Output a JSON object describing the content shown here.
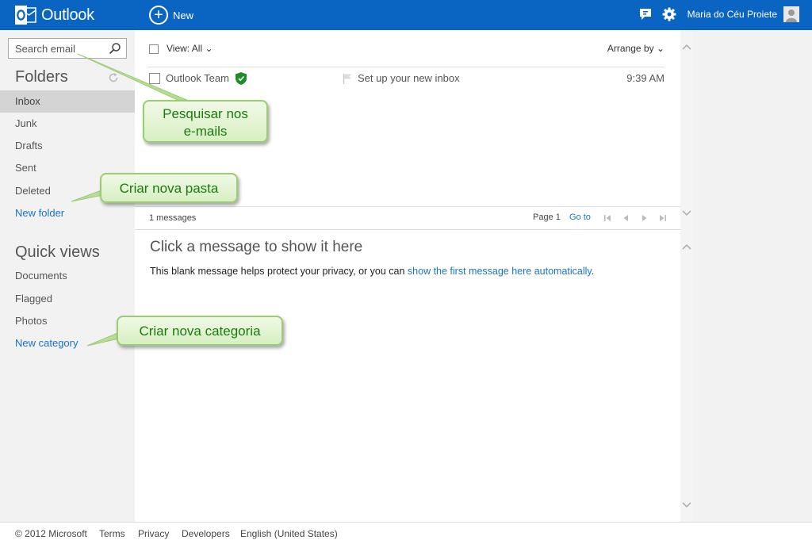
{
  "header": {
    "app_name": "Outlook",
    "new_label": "New",
    "user_name": "Maria do Céu Proiete",
    "brand_color": "#0a64c2"
  },
  "sidebar": {
    "search_placeholder": "Search email",
    "folders_title": "Folders",
    "folders": [
      {
        "label": "Inbox",
        "active": true
      },
      {
        "label": "Junk"
      },
      {
        "label": "Drafts"
      },
      {
        "label": "Sent"
      },
      {
        "label": "Deleted"
      }
    ],
    "new_folder": "New folder",
    "quick_views_title": "Quick views",
    "quick_views": [
      {
        "label": "Documents"
      },
      {
        "label": "Flagged"
      },
      {
        "label": "Photos"
      }
    ],
    "new_category": "New category"
  },
  "list": {
    "view_filter": "View: All",
    "arrange_by": "Arrange by",
    "messages": [
      {
        "sender": "Outlook Team",
        "subject": "Set up your new inbox",
        "time": "9:39 AM",
        "verified_icon": "shield-icon"
      }
    ],
    "count_text": "1 messages",
    "page_text": "Page 1",
    "goto_label": "Go to"
  },
  "reading": {
    "title": "Click a message to show it here",
    "text": "This blank message helps protect your privacy, or you can ",
    "link": "show the first message here automatically",
    "text_end": "."
  },
  "footer": {
    "copyright": "© 2012 Microsoft",
    "terms": "Terms",
    "privacy": "Privacy",
    "developers": "Developers",
    "language": "English (United States)"
  },
  "callouts": {
    "search": "Pesquisar nos e-mails",
    "new_folder": "Criar nova pasta",
    "new_category": "Criar nova categoria"
  }
}
